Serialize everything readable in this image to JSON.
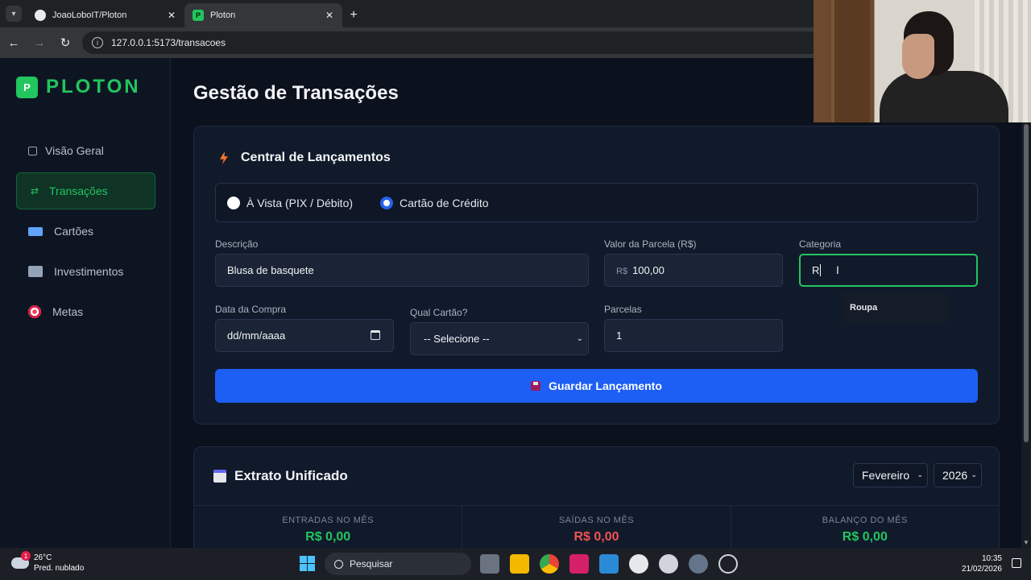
{
  "browser": {
    "tabs": [
      {
        "title": "JoaoLoboIT/Ploton",
        "active": false
      },
      {
        "title": "Ploton",
        "active": true
      }
    ],
    "url": "127.0.0.1:5173/transacoes"
  },
  "sidebar": {
    "brand_letter": "P",
    "brand_name": "PLOTON",
    "items": [
      {
        "label": "Visão Geral",
        "icon": "dashboard-icon"
      },
      {
        "label": "Transações",
        "icon": "swap-arrows-icon",
        "active": true
      },
      {
        "label": "Cartões",
        "icon": "credit-card-icon"
      },
      {
        "label": "Investimentos",
        "icon": "chart-icon"
      },
      {
        "label": "Metas",
        "icon": "target-icon"
      }
    ]
  },
  "page": {
    "title": "Gestão de Transações"
  },
  "launch_card": {
    "title": "Central de Lançamentos",
    "payment_options": [
      "À Vista (PIX / Débito)",
      "Cartão de Crédito"
    ],
    "selected_payment": "Cartão de Crédito",
    "fields": {
      "description": {
        "label": "Descrição",
        "value": "Blusa de basquete"
      },
      "installment_value": {
        "label": "Valor da Parcela (R$)",
        "prefix": "R$",
        "value": "100,00"
      },
      "category": {
        "label": "Categoria",
        "value": "R",
        "suggestion": "Roupa"
      },
      "purchase_date": {
        "label": "Data da Compra",
        "placeholder": "dd/mm/aaaa"
      },
      "card": {
        "label": "Qual Cartão?",
        "value": "-- Selecione --"
      },
      "installments": {
        "label": "Parcelas",
        "value": "1"
      }
    },
    "save_label": "Guardar Lançamento"
  },
  "statement": {
    "title": "Extrato Unificado",
    "month": "Fevereiro",
    "year": "2026",
    "stats": [
      {
        "label": "ENTRADAS NO MÊS",
        "value": "R$ 0,00",
        "color": "#22c55e"
      },
      {
        "label": "SAÍDAS NO MÊS",
        "value": "R$ 0,00",
        "color": "#f05252"
      },
      {
        "label": "BALANÇO DO MÊS",
        "value": "R$ 0,00",
        "color": "#22c55e"
      }
    ]
  },
  "taskbar": {
    "weather_temp": "26°C",
    "weather_desc": "Pred. nublado",
    "weather_badge": "1",
    "search_placeholder": "Pesquisar",
    "time": "10:35",
    "date": "21/02/2026"
  },
  "colors": {
    "accent_green": "#22c55e",
    "primary_blue": "#1d5ef5",
    "expense_red": "#f05252"
  }
}
